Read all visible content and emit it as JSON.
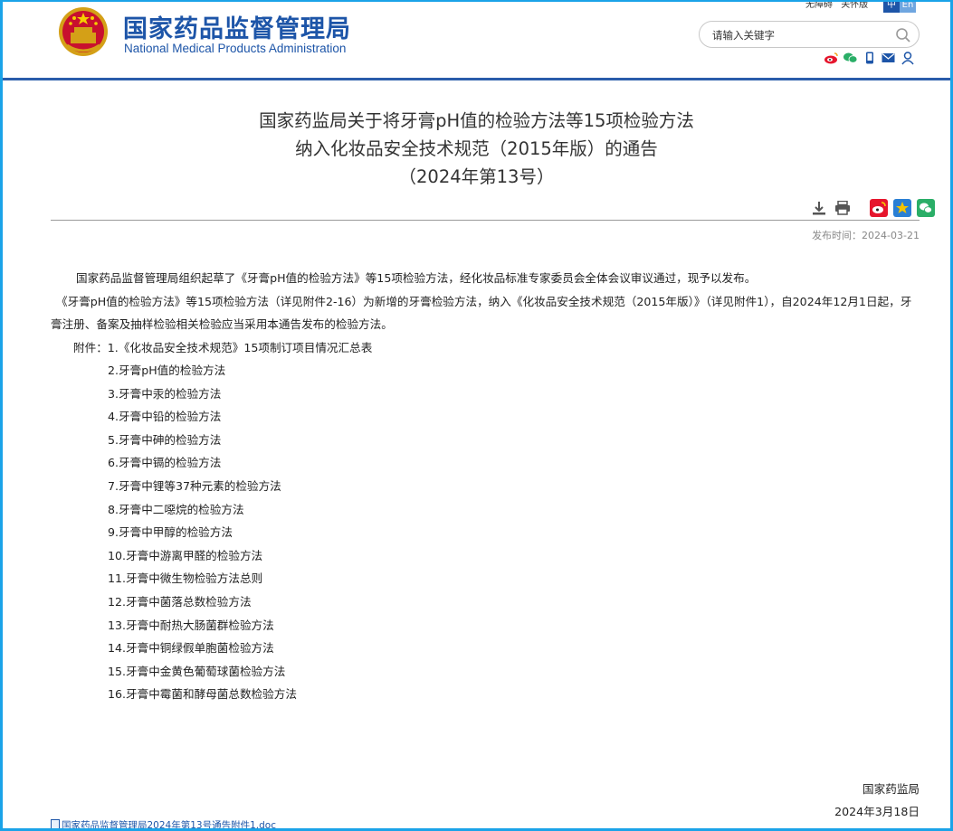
{
  "header": {
    "site_name_cn": "国家药品监督管理局",
    "site_name_en": "National Medical Products Administration",
    "top_links": [
      "无障碍",
      "关怀版"
    ],
    "lang_cn": "中",
    "lang_en": "En",
    "search_placeholder": "请输入关键字",
    "social_icons": [
      "weibo-icon",
      "wechat-icon",
      "mobile-icon",
      "mail-icon",
      "user-icon"
    ],
    "brand_color": "#1d55a8"
  },
  "article": {
    "title_lines": [
      "国家药监局关于将牙膏pH值的检验方法等15项检验方法",
      "纳入化妆品安全技术规范（2015年版）的通告",
      "（2024年第13号）"
    ],
    "tool_icons": [
      "download-icon",
      "print-icon",
      "weibo-share-icon",
      "favorite-icon",
      "wechat-share-icon"
    ],
    "publish_label": "发布时间：2024-03-21",
    "para1": "国家药品监督管理局组织起草了《牙膏pH值的检验方法》等15项检验方法，经化妆品标准专家委员会全体会议审议通过，现予以发布。",
    "para2": "《牙膏pH值的检验方法》等15项检验方法（详见附件2-16）为新增的牙膏检验方法，纳入《化妆品安全技术规范（2015年版）》（详见附件1），自2024年12月1日起，牙膏注册、备案及抽样检验相关检验应当采用本通告发布的检验方法。",
    "attachments_label": "附件：",
    "attachments": [
      "1.《化妆品安全技术规范》15项制订项目情况汇总表",
      "2.牙膏pH值的检验方法",
      "3.牙膏中汞的检验方法",
      "4.牙膏中铅的检验方法",
      "5.牙膏中砷的检验方法",
      "6.牙膏中镉的检验方法",
      "7.牙膏中锂等37种元素的检验方法",
      "8.牙膏中二噁烷的检验方法",
      "9.牙膏中甲醇的检验方法",
      "10.牙膏中游离甲醛的检验方法",
      "11.牙膏中微生物检验方法总则",
      "12.牙膏中菌落总数检验方法",
      "13.牙膏中耐热大肠菌群检验方法",
      "14.牙膏中铜绿假单胞菌检验方法",
      "15.牙膏中金黄色葡萄球菌检验方法",
      "16.牙膏中霉菌和酵母菌总数检验方法"
    ],
    "signature": "国家药监局",
    "sign_date": "2024年3月18日",
    "download_link": "国家药品监督管理局2024年第13号通告附件1.doc"
  }
}
